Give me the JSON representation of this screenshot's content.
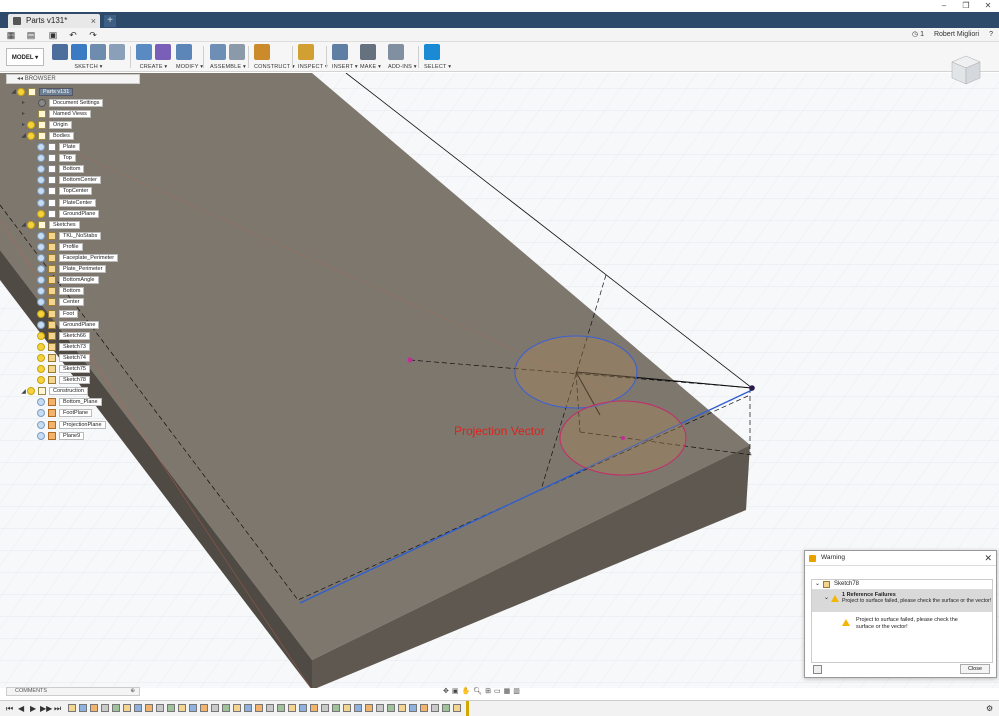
{
  "window": {
    "tab_title": "Parts v131*",
    "tab_close": "×",
    "tab_add": "+",
    "controls": [
      "–",
      "❐",
      "✕"
    ]
  },
  "quick_access": {
    "grid_icon": "app-grid-icon",
    "file_icon": "file-icon",
    "save_icon": "save-icon",
    "undo_icon": "undo-icon",
    "redo_icon": "redo-icon",
    "job_count": "1",
    "user_name": "Robert Migliori",
    "help_icon": "?"
  },
  "toolbar": {
    "workspace": "MODEL ▾",
    "groups": [
      {
        "label": "SKETCH ▾",
        "colors": [
          "#4b6e9c",
          "#3b7bc4",
          "#6e8cae",
          "#8aa0b8"
        ]
      },
      {
        "label": "CREATE ▾",
        "colors": [
          "#5a8ac2",
          "#7a5fb8"
        ]
      },
      {
        "label": "MODIFY ▾",
        "colors": [
          "#5c86b8"
        ]
      },
      {
        "label": "ASSEMBLE ▾",
        "colors": [
          "#6d8fb5",
          "#8b9aa8"
        ]
      },
      {
        "label": "CONSTRUCT ▾",
        "colors": [
          "#cc8b2a"
        ]
      },
      {
        "label": "INSPECT ▾",
        "colors": [
          "#d2a032"
        ]
      },
      {
        "label": "INSERT ▾",
        "colors": [
          "#5e7ea3"
        ]
      },
      {
        "label": "MAKE ▾",
        "colors": [
          "#65717e"
        ]
      },
      {
        "label": "ADD-INS ▾",
        "colors": [
          "#8190a0"
        ]
      },
      {
        "label": "SELECT ▾",
        "colors": [
          "#1a8ad4"
        ]
      }
    ]
  },
  "browser": {
    "title": "BROWSER",
    "items": [
      {
        "label": "Parts v131",
        "exp": "◢",
        "bulb": "on",
        "icon": "folder",
        "indent": 0,
        "root": true
      },
      {
        "label": "Document Settings",
        "exp": "▸",
        "bulb": "",
        "icon": "gear",
        "indent": 1
      },
      {
        "label": "Named Views",
        "exp": "▸",
        "bulb": "",
        "icon": "folder",
        "indent": 1
      },
      {
        "label": "Origin",
        "exp": "▸",
        "bulb": "on",
        "icon": "folder",
        "indent": 1
      },
      {
        "label": "Bodies",
        "exp": "◢",
        "bulb": "on",
        "icon": "folder",
        "indent": 1
      },
      {
        "label": "Plate",
        "exp": "",
        "bulb": "off",
        "icon": "body",
        "indent": 2
      },
      {
        "label": "Top",
        "exp": "",
        "bulb": "off",
        "icon": "body",
        "indent": 2
      },
      {
        "label": "Bottom",
        "exp": "",
        "bulb": "off",
        "icon": "body",
        "indent": 2
      },
      {
        "label": "BottomCenter",
        "exp": "",
        "bulb": "off",
        "icon": "body",
        "indent": 2
      },
      {
        "label": "TopCenter",
        "exp": "",
        "bulb": "off",
        "icon": "body",
        "indent": 2
      },
      {
        "label": "PlateCenter",
        "exp": "",
        "bulb": "off",
        "icon": "body",
        "indent": 2
      },
      {
        "label": "GroundPlane",
        "exp": "",
        "bulb": "on",
        "icon": "body",
        "indent": 2
      },
      {
        "label": "Sketches",
        "exp": "◢",
        "bulb": "on",
        "icon": "folder",
        "indent": 1
      },
      {
        "label": "TKL_NoStabs",
        "exp": "",
        "bulb": "off",
        "icon": "sketch",
        "indent": 2
      },
      {
        "label": "Profile",
        "exp": "",
        "bulb": "off",
        "icon": "sketch",
        "indent": 2
      },
      {
        "label": "Faceplate_Perimeter",
        "exp": "",
        "bulb": "off",
        "icon": "sketch",
        "indent": 2
      },
      {
        "label": "Plate_Perimeter",
        "exp": "",
        "bulb": "off",
        "icon": "sketch",
        "indent": 2
      },
      {
        "label": "BottomAngle",
        "exp": "",
        "bulb": "off",
        "icon": "sketch",
        "indent": 2
      },
      {
        "label": "Bottom",
        "exp": "",
        "bulb": "off",
        "icon": "sketch",
        "indent": 2
      },
      {
        "label": "Center",
        "exp": "",
        "bulb": "off",
        "icon": "sketch",
        "indent": 2
      },
      {
        "label": "Foot",
        "exp": "",
        "bulb": "on",
        "icon": "sketch",
        "indent": 2
      },
      {
        "label": "GroundPlane",
        "exp": "",
        "bulb": "off",
        "icon": "sketch",
        "indent": 2
      },
      {
        "label": "Sketch66",
        "exp": "",
        "bulb": "on",
        "icon": "sketch",
        "indent": 2
      },
      {
        "label": "Sketch73",
        "exp": "",
        "bulb": "on",
        "icon": "sketch",
        "indent": 2
      },
      {
        "label": "Sketch74",
        "exp": "",
        "bulb": "on",
        "icon": "sketch",
        "indent": 2
      },
      {
        "label": "Sketch75",
        "exp": "",
        "bulb": "on",
        "icon": "sketch",
        "indent": 2
      },
      {
        "label": "Sketch78",
        "exp": "",
        "bulb": "on",
        "icon": "sketch",
        "indent": 2
      },
      {
        "label": "Construction",
        "exp": "◢",
        "bulb": "on",
        "icon": "folder",
        "indent": 1
      },
      {
        "label": "Bottom_Plane",
        "exp": "",
        "bulb": "off",
        "icon": "plane",
        "indent": 2
      },
      {
        "label": "FootPlane",
        "exp": "",
        "bulb": "off",
        "icon": "plane",
        "indent": 2
      },
      {
        "label": "ProjectionPlane",
        "exp": "",
        "bulb": "off",
        "icon": "plane",
        "indent": 2
      },
      {
        "label": "Plane9",
        "exp": "",
        "bulb": "off",
        "icon": "plane",
        "indent": 2
      }
    ]
  },
  "canvas": {
    "annotation": "Projection Vector",
    "annotation_color": "#e0201c",
    "body_top_color": "#7e776d",
    "body_side_color": "#5e5850",
    "body_front_color": "#4f4a43",
    "grid_color": "#d8dde3"
  },
  "dialog": {
    "title": "Warning",
    "close_glyph": "✕",
    "sketch_name": "Sketch78",
    "failure_title": "1 Reference Failures",
    "failure_detail": "Project to surface failed, please check the surface or the vector!",
    "message": "Project to surface failed, please check the surface or the vector!",
    "close_label": "Close"
  },
  "comments": {
    "label": "COMMENTS"
  },
  "timeline": {
    "controls": [
      "⏮",
      "◀",
      "▶",
      "▶▶",
      "⏭"
    ]
  }
}
